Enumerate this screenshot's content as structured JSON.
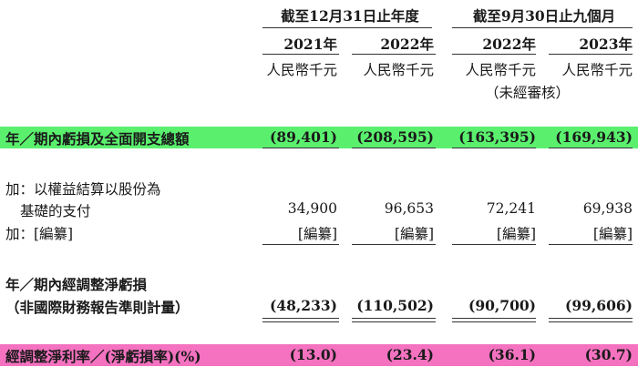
{
  "header": {
    "group1_title": "截至12月31日止年度",
    "group2_title": "截至9月30日止九個月",
    "years": [
      "2021年",
      "2022年",
      "2022年",
      "2023年"
    ],
    "units": [
      "人民幣千元",
      "人民幣千元",
      "人民幣千元",
      "人民幣千元"
    ],
    "unaudited": "（未經審核）"
  },
  "colors": {
    "green_highlight": "#5af06e",
    "pink_highlight": "#f472c0"
  },
  "rows": {
    "total_loss": {
      "label": "年／期內虧損及全面開支總額",
      "values": [
        "(89,401)",
        "(208,595)",
        "(163,395)",
        "(169,943)"
      ]
    },
    "add_share_label1": "加：以權益結算以股份為",
    "add_share": {
      "label": "基礎的支付",
      "values": [
        "34,900",
        "96,653",
        "72,241",
        "69,938"
      ]
    },
    "add_redacted": {
      "label": "加：[編纂]",
      "values": [
        "[編纂]",
        "[編纂]",
        "[編纂]",
        "[編纂]"
      ]
    },
    "adjusted_label1": "年／期內經調整淨虧損",
    "adjusted": {
      "label": "（非國際財務報告準則計量）",
      "values": [
        "(48,233)",
        "(110,502)",
        "(90,700)",
        "(99,606)"
      ]
    },
    "margin": {
      "label": "經調整淨利率／(淨虧損率)(%)",
      "values": [
        "(13.0)",
        "(23.4)",
        "(36.1)",
        "(30.7)"
      ]
    }
  }
}
